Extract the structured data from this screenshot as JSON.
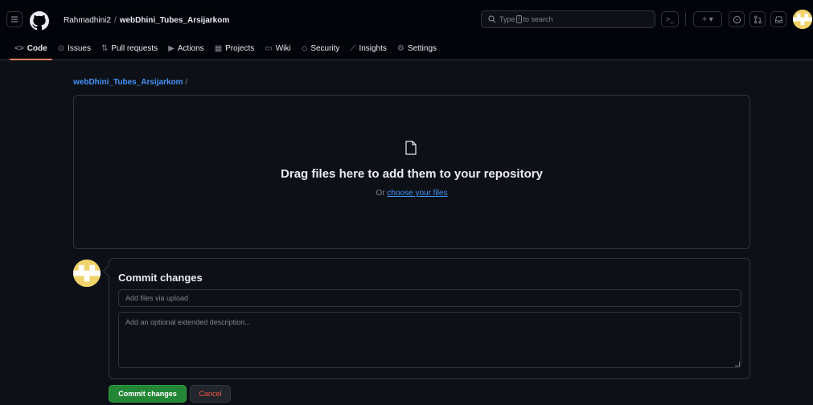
{
  "header": {
    "owner": "Rahmadhini2",
    "separator": "/",
    "repo": "webDhini_Tubes_Arsijarkom",
    "search_prefix": "Type",
    "search_key": "/",
    "search_suffix": "to search",
    "plus_label": "+ ▾",
    "cmd_label": ">_"
  },
  "tabs": [
    {
      "icon": "<>",
      "label": "Code"
    },
    {
      "icon": "⊙",
      "label": "Issues"
    },
    {
      "icon": "⇅",
      "label": "Pull requests"
    },
    {
      "icon": "▶",
      "label": "Actions"
    },
    {
      "icon": "▦",
      "label": "Projects"
    },
    {
      "icon": "▭",
      "label": "Wiki"
    },
    {
      "icon": "◇",
      "label": "Security"
    },
    {
      "icon": "⟋",
      "label": "Insights"
    },
    {
      "icon": "⚙",
      "label": "Settings"
    }
  ],
  "breadcrumb": {
    "repo": "webDhini_Tubes_Arsijarkom",
    "slash": "/"
  },
  "dropzone": {
    "title": "Drag files here to add them to your repository",
    "or_text": "Or",
    "choose_link": "choose your files"
  },
  "commit": {
    "title": "Commit changes",
    "summary_placeholder": "Add files via upload",
    "description_placeholder": "Add an optional extended description...",
    "commit_button": "Commit changes",
    "cancel_button": "Cancel"
  },
  "colors": {
    "background": "#0d1117",
    "header_bg": "#010409",
    "link": "#4493f8",
    "primary_button": "#238636",
    "danger": "#f85149",
    "active_tab_underline": "#f78166"
  }
}
